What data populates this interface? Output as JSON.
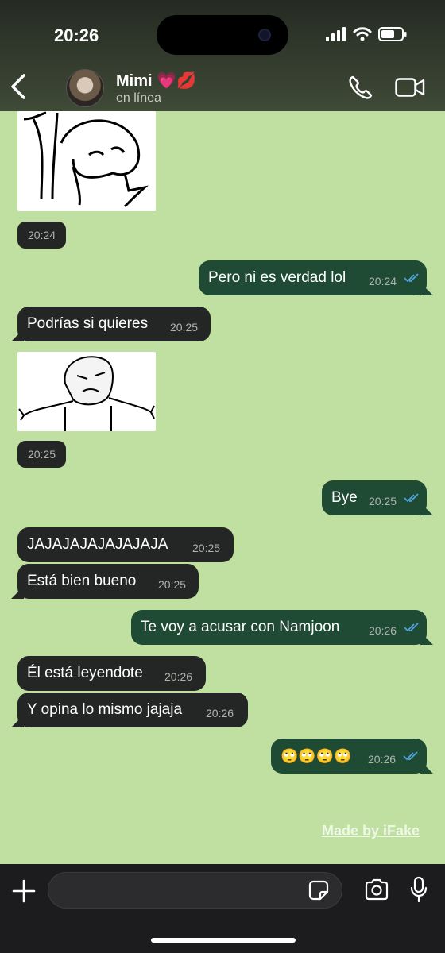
{
  "status_bar": {
    "time": "20:26"
  },
  "header": {
    "contact_name": "Mimi 💗💋",
    "contact_status": "en línea"
  },
  "messages": [
    {
      "kind": "sticker",
      "direction": "in",
      "time": "20:24",
      "icon": "shrug-doodle-sticker"
    },
    {
      "kind": "text",
      "direction": "out",
      "text": "Pero ni es verdad lol",
      "time": "20:24",
      "read": true
    },
    {
      "kind": "text",
      "direction": "in",
      "text": "Podrías si quieres",
      "time": "20:25"
    },
    {
      "kind": "sticker",
      "direction": "in",
      "time": "20:25",
      "icon": "shrug-meme-sticker"
    },
    {
      "kind": "text",
      "direction": "out",
      "text": "Bye",
      "time": "20:25",
      "read": true
    },
    {
      "kind": "text",
      "direction": "in",
      "text": "JAJAJAJAJAJAJAJA",
      "time": "20:25"
    },
    {
      "kind": "text",
      "direction": "in",
      "text": "Está bien bueno",
      "time": "20:25"
    },
    {
      "kind": "text",
      "direction": "out",
      "text": "Te voy a acusar con Namjoon",
      "time": "20:26",
      "read": true
    },
    {
      "kind": "text",
      "direction": "in",
      "text": "Él está leyendote",
      "time": "20:26"
    },
    {
      "kind": "text",
      "direction": "in",
      "text": "Y opina lo mismo jajaja",
      "time": "20:26"
    },
    {
      "kind": "text",
      "direction": "out",
      "text": "🙄🙄🙄🙄",
      "time": "20:26",
      "read": true
    }
  ],
  "watermark": "Made by iFake",
  "input": {
    "placeholder": ""
  },
  "colors": {
    "chat_background": "#bfe0a0",
    "incoming_bubble": "#242625",
    "outgoing_bubble": "#1f4a33",
    "read_ticks": "#4fa3e0"
  }
}
